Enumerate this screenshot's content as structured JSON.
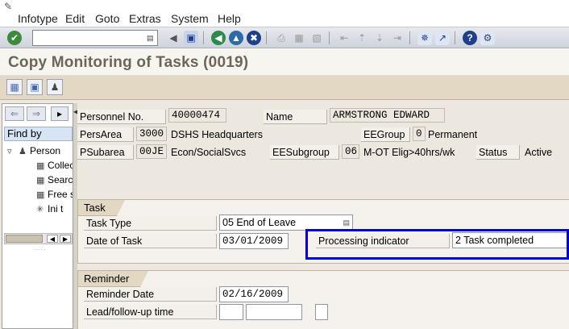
{
  "menubar": {
    "items": [
      "Infotype",
      "Edit",
      "Goto",
      "Extras",
      "System",
      "Help"
    ]
  },
  "toolbar": {
    "command_value": "",
    "icons": [
      "enter-icon",
      "dropdown-icon",
      "back-arrow-icon",
      "save-icon",
      "back-icon",
      "exit-icon",
      "cancel-icon",
      "print-icon",
      "find-icon",
      "find-next-icon",
      "first-page-icon",
      "previous-page-icon",
      "next-page-icon",
      "last-page-icon",
      "create-session-icon",
      "shortcut-icon",
      "help-icon",
      "customize-layout-icon"
    ]
  },
  "title": "Copy Monitoring of Tasks (0019)",
  "app_toolbar": {
    "icons": [
      "copy-icon",
      "delimit-icon",
      "org-structure-icon"
    ]
  },
  "nav": {
    "find_by": "Find by",
    "tree": [
      {
        "label": "Person",
        "icon": "persons-icon"
      },
      {
        "label": "Collective search help",
        "icon": "binoculars-icon"
      },
      {
        "label": "Search term",
        "icon": "binoculars-icon"
      },
      {
        "label": "Free search",
        "icon": "binoculars-icon"
      },
      {
        "label": "Ini t",
        "icon": "ini-icon"
      }
    ]
  },
  "header": {
    "personnel_no_label": "Personnel No.",
    "personnel_no": "40000474",
    "name_label": "Name",
    "name": "ARMSTRONG EDWARD",
    "persarea_label": "PersArea",
    "persarea_code": "3000",
    "persarea_text": "DSHS Headquarters",
    "eegroup_label": "EEGroup",
    "eegroup_code": "0",
    "eegroup_text": "Permanent",
    "psubarea_label": "PSubarea",
    "psubarea_code": "00JE",
    "psubarea_text": "Econ/SocialSvcs",
    "eesubgroup_label": "EESubgroup",
    "eesubgroup_code": "06",
    "eesubgroup_text": "M-OT Elig>40hrs/wk",
    "status_label": "Status",
    "status_value": "Active"
  },
  "task": {
    "group_title": "Task",
    "task_type_label": "Task Type",
    "task_type_value": "05 End of Leave",
    "date_label": "Date of Task",
    "date_value": "03/01/2009",
    "processing_label": "Processing indicator",
    "processing_value": "2 Task completed"
  },
  "reminder": {
    "group_title": "Reminder",
    "date_label": "Reminder Date",
    "date_value": "02/16/2009",
    "lead_label": "Lead/follow-up time",
    "lead_value": "",
    "unit_value": "",
    "check_value": ""
  },
  "colors": {
    "highlight": "#0000dd",
    "title_text": "#6c6658",
    "app_toolbar_bg": "#e2d8c3"
  }
}
